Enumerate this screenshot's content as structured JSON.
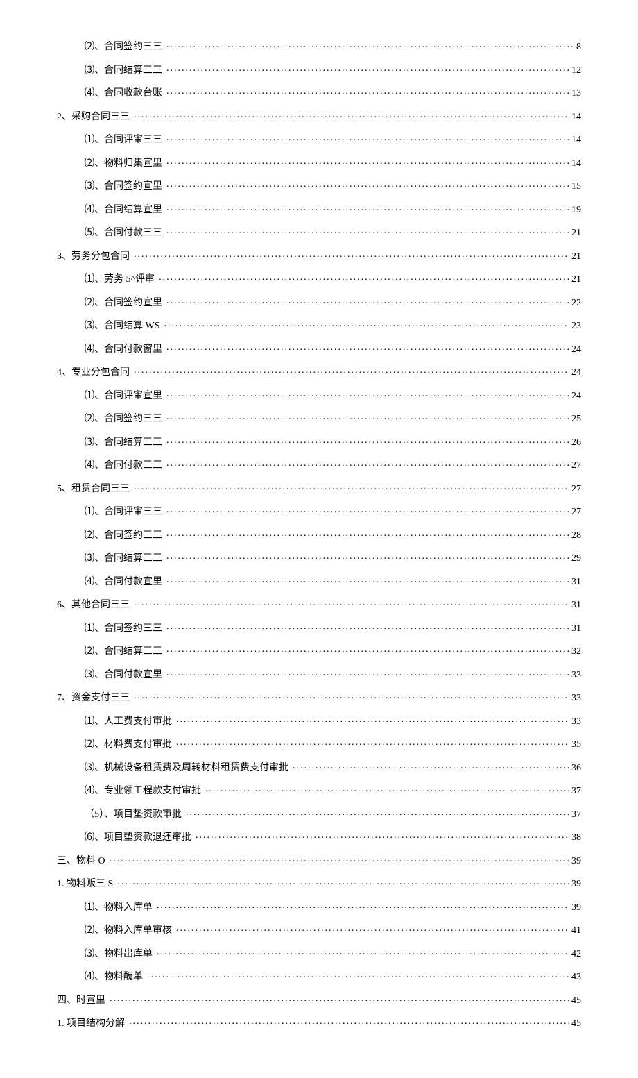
{
  "toc": [
    {
      "level": 2,
      "label": "⑵、合同签约三三",
      "page": "8"
    },
    {
      "level": 2,
      "label": "⑶、合同结算三三",
      "page": "12"
    },
    {
      "level": 2,
      "label": "⑷、合同收款台账",
      "page": "13"
    },
    {
      "level": 1,
      "label": "2、采购合同三三",
      "page": "14"
    },
    {
      "level": 2,
      "label": "⑴、合同评审三三",
      "page": "14"
    },
    {
      "level": 2,
      "label": "⑵、物料归集宣里",
      "page": "14"
    },
    {
      "level": 2,
      "label": "⑶、合同签约宣里",
      "page": "15"
    },
    {
      "level": 2,
      "label": "⑷、合同结算宣里",
      "page": "19"
    },
    {
      "level": 2,
      "label": "⑸、合同付款三三",
      "page": "21"
    },
    {
      "level": 1,
      "label": "3、劳务分包合同",
      "page": "21"
    },
    {
      "level": 2,
      "label": "⑴、劳务 5^评审",
      "page": "21"
    },
    {
      "level": 2,
      "label": "⑵、合同签约宣里",
      "page": "22"
    },
    {
      "level": 2,
      "label": "⑶、合同结算 WS",
      "page": "23"
    },
    {
      "level": 2,
      "label": "⑷、合同付款窗里",
      "page": "24"
    },
    {
      "level": 1,
      "label": "4、专业分包合同",
      "page": "24"
    },
    {
      "level": 2,
      "label": "⑴、合同评审宣里",
      "page": "24"
    },
    {
      "level": 2,
      "label": "⑵、合同签约三三",
      "page": "25"
    },
    {
      "level": 2,
      "label": "⑶、合同结算三三",
      "page": "26"
    },
    {
      "level": 2,
      "label": "⑷、合同付款三三",
      "page": "27"
    },
    {
      "level": 1,
      "label": "5、租赁合同三三",
      "page": "27"
    },
    {
      "level": 2,
      "label": "⑴、合同评审三三",
      "page": "27"
    },
    {
      "level": 2,
      "label": "⑵、合同签约三三",
      "page": "28"
    },
    {
      "level": 2,
      "label": "⑶、合同结算三三",
      "page": "29"
    },
    {
      "level": 2,
      "label": "⑷、合同付款宣里",
      "page": "31"
    },
    {
      "level": 1,
      "label": "6、其他合同三三",
      "page": "31"
    },
    {
      "level": 2,
      "label": "⑴、合同签约三三",
      "page": "31"
    },
    {
      "level": 2,
      "label": "⑵、合同结算三三",
      "page": "32"
    },
    {
      "level": 2,
      "label": "⑶、合同付款宣里",
      "page": "33"
    },
    {
      "level": 1,
      "label": "7、资金支付三三",
      "page": "33"
    },
    {
      "level": 2,
      "label": "⑴、人工费支付审批",
      "page": "33"
    },
    {
      "level": 2,
      "label": "⑵、材料费支付审批",
      "page": "35"
    },
    {
      "level": 2,
      "label": "⑶、机械设备租赁费及周转材料租赁费支付审批",
      "page": "36"
    },
    {
      "level": 2,
      "label": "⑷、专业领工程款支付审批",
      "page": "37"
    },
    {
      "level": 2,
      "label": "（5）、项目垫资款审批",
      "page": "37"
    },
    {
      "level": 2,
      "label": "⑹、项目垫资款退还审批",
      "page": "38"
    },
    {
      "level": 1,
      "label": "三、物料 O",
      "page": "39"
    },
    {
      "level": 1,
      "label": "1. 物料贩三 S",
      "page": "39"
    },
    {
      "level": 2,
      "label": "⑴、物料入库单",
      "page": "39"
    },
    {
      "level": 2,
      "label": "⑵、物料入库单审核",
      "page": "41"
    },
    {
      "level": 2,
      "label": "⑶、物料出库单",
      "page": "42"
    },
    {
      "level": 2,
      "label": "⑷、物料醜单",
      "page": "43"
    },
    {
      "level": 1,
      "label": "四、时宣里",
      "page": "45"
    },
    {
      "level": 1,
      "label": "1. 项目结构分解",
      "page": "45"
    }
  ]
}
